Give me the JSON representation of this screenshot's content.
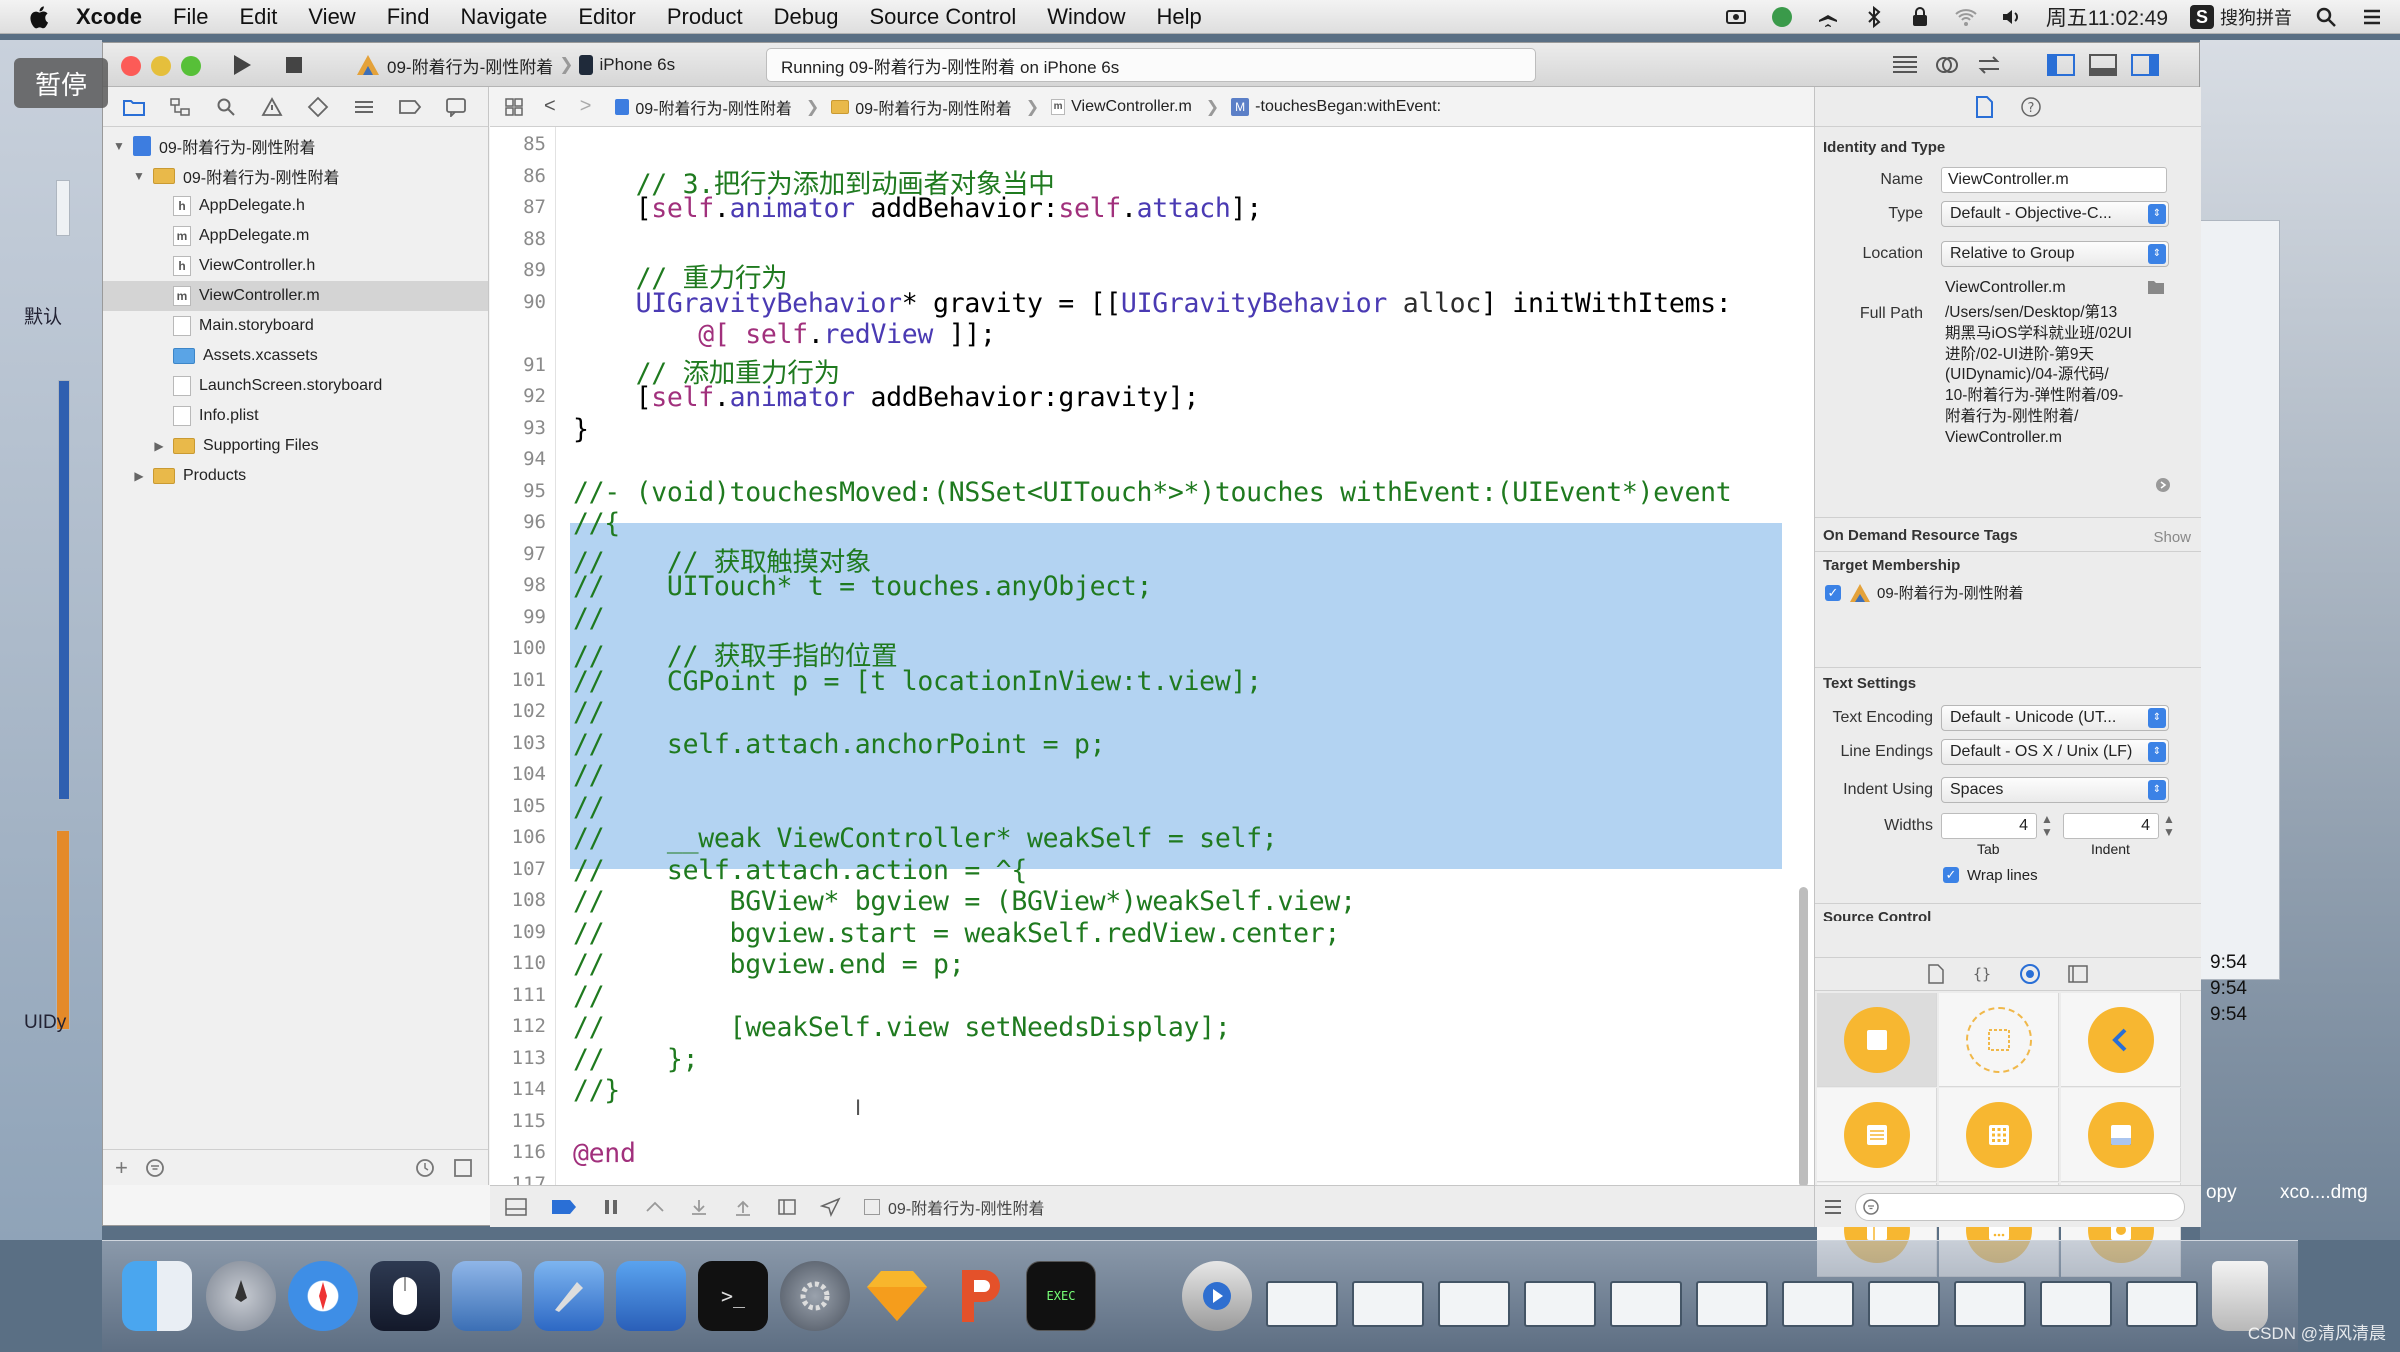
{
  "menubar": {
    "app_name": "Xcode",
    "items": [
      "File",
      "Edit",
      "View",
      "Find",
      "Navigate",
      "Editor",
      "Product",
      "Debug",
      "Source Control",
      "Window",
      "Help"
    ],
    "clock": "周五11:02:49",
    "input_method": "搜狗拼音"
  },
  "overlay": {
    "pause_label": "暂停"
  },
  "toolbar": {
    "scheme": "09-附着行为-刚性附着",
    "device": "iPhone 6s",
    "activity": "Running 09-附着行为-刚性附着 on iPhone 6s"
  },
  "navigator": {
    "rows": [
      {
        "label": "09-附着行为-刚性附着",
        "kind": "project",
        "disclosure": "▼"
      },
      {
        "label": "09-附着行为-刚性附着",
        "kind": "folder",
        "disclosure": "▼"
      },
      {
        "label": "AppDelegate.h",
        "kind": "h",
        "disclosure": ""
      },
      {
        "label": "AppDelegate.m",
        "kind": "m",
        "disclosure": ""
      },
      {
        "label": "ViewController.h",
        "kind": "h",
        "disclosure": ""
      },
      {
        "label": "ViewController.m",
        "kind": "m",
        "disclosure": "",
        "selected": true
      },
      {
        "label": "Main.storyboard",
        "kind": "file",
        "disclosure": ""
      },
      {
        "label": "Assets.xcassets",
        "kind": "bluefolder",
        "disclosure": ""
      },
      {
        "label": "LaunchScreen.storyboard",
        "kind": "file",
        "disclosure": ""
      },
      {
        "label": "Info.plist",
        "kind": "file",
        "disclosure": ""
      },
      {
        "label": "Supporting Files",
        "kind": "folder",
        "disclosure": "▶"
      },
      {
        "label": "Products",
        "kind": "folder",
        "disclosure": "▶"
      }
    ]
  },
  "jumpbar": {
    "project": "09-附着行为-刚性附着",
    "group": "09-附着行为-刚性附着",
    "file": "ViewController.m",
    "symbol": "-touchesBegan:withEvent:"
  },
  "editor": {
    "lines": [
      {
        "n": "85",
        "text": ""
      },
      {
        "n": "86",
        "text": "    // 3.把行为添加到动画者对象当中"
      },
      {
        "n": "87",
        "text": "    [self.animator addBehavior:self.attach];"
      },
      {
        "n": "88",
        "text": ""
      },
      {
        "n": "89",
        "text": "    // 重力行为"
      },
      {
        "n": "90",
        "text": "    UIGravityBehavior* gravity = [[UIGravityBehavior alloc] initWithItems:"
      },
      {
        "n": "",
        "text": "        @[ self.redView ]];"
      },
      {
        "n": "91",
        "text": "    // 添加重力行为"
      },
      {
        "n": "92",
        "text": "    [self.animator addBehavior:gravity];"
      },
      {
        "n": "93",
        "text": "}"
      },
      {
        "n": "94",
        "text": ""
      },
      {
        "n": "95",
        "text": "//- (void)touchesMoved:(NSSet<UITouch*>*)touches withEvent:(UIEvent*)event"
      },
      {
        "n": "96",
        "text": "//{"
      },
      {
        "n": "97",
        "text": "//    // 获取触摸对象"
      },
      {
        "n": "98",
        "text": "//    UITouch* t = touches.anyObject;"
      },
      {
        "n": "99",
        "text": "//"
      },
      {
        "n": "100",
        "text": "//    // 获取手指的位置"
      },
      {
        "n": "101",
        "text": "//    CGPoint p = [t locationInView:t.view];"
      },
      {
        "n": "102",
        "text": "//"
      },
      {
        "n": "103",
        "text": "//    self.attach.anchorPoint = p;"
      },
      {
        "n": "104",
        "text": "//"
      },
      {
        "n": "105",
        "text": "//"
      },
      {
        "n": "106",
        "text": "//    __weak ViewController* weakSelf = self;"
      },
      {
        "n": "107",
        "text": "//    self.attach.action = ^{"
      },
      {
        "n": "108",
        "text": "//        BGView* bgview = (BGView*)weakSelf.view;"
      },
      {
        "n": "109",
        "text": "//        bgview.start = weakSelf.redView.center;"
      },
      {
        "n": "110",
        "text": "//        bgview.end = p;"
      },
      {
        "n": "111",
        "text": "//"
      },
      {
        "n": "112",
        "text": "//        [weakSelf.view setNeedsDisplay];"
      },
      {
        "n": "113",
        "text": "//    };"
      },
      {
        "n": "114",
        "text": "//}"
      },
      {
        "n": "115",
        "text": ""
      },
      {
        "n": "116",
        "text": "@end"
      },
      {
        "n": "117",
        "text": ""
      }
    ]
  },
  "debugbar": {
    "target": "09-附着行为-刚性附着"
  },
  "inspector": {
    "identity_title": "Identity and Type",
    "name_label": "Name",
    "name_value": "ViewController.m",
    "type_label": "Type",
    "type_value": "Default - Objective-C...",
    "location_label": "Location",
    "location_value": "Relative to Group",
    "location_file": "ViewController.m",
    "fullpath_label": "Full Path",
    "fullpath_lines": [
      "/Users/sen/Desktop/第13",
      "期黑马iOS学科就业班/02UI",
      "进阶/02-UI进阶-第9天",
      "(UIDynamic)/04-源代码/",
      "10-附着行为-弹性附着/09-",
      "附着行为-刚性附着/",
      "ViewController.m"
    ],
    "ondemand_title": "On Demand Resource Tags",
    "ondemand_show": "Show",
    "target_title": "Target Membership",
    "target_item": "09-附着行为-刚性附着",
    "text_settings_title": "Text Settings",
    "encoding_label": "Text Encoding",
    "encoding_value": "Default - Unicode (UT...",
    "line_endings_label": "Line Endings",
    "line_endings_value": "Default - OS X / Unix (LF)",
    "indent_using_label": "Indent Using",
    "indent_using_value": "Spaces",
    "widths_label": "Widths",
    "tab_value": "4",
    "indent_value": "4",
    "tab_label": "Tab",
    "indent_label": "Indent",
    "wrap_label": "Wrap lines",
    "source_control_title": "Source Control"
  },
  "desktop": {
    "right_labels": [
      "9:54",
      "9:54",
      "9:54"
    ],
    "bottom_right_labels": [
      "opy",
      "xco....dmg"
    ],
    "left_labels": [
      "默认",
      "UIDy"
    ]
  },
  "watermark": "CSDN @清风清晨"
}
